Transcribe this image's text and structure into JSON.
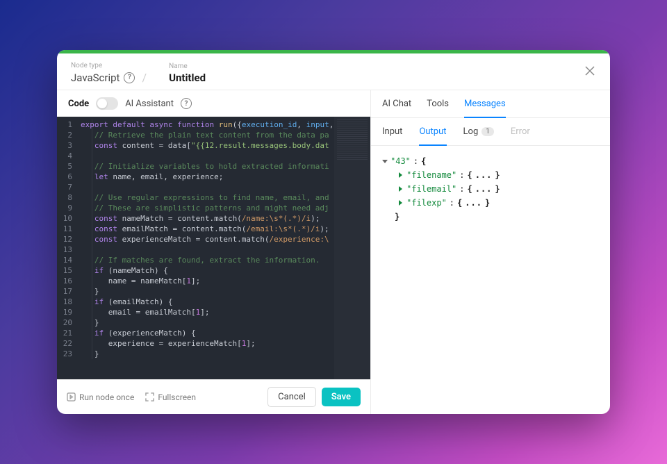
{
  "header": {
    "nodetype_label": "Node type",
    "nodetype_value": "JavaScript",
    "name_label": "Name",
    "name_value": "Untitled"
  },
  "left_tabs": {
    "code": "Code",
    "ai": "AI Assistant"
  },
  "footer": {
    "run_once": "Run node once",
    "fullscreen": "Fullscreen",
    "cancel": "Cancel",
    "save": "Save"
  },
  "right_tabs_1": {
    "ai_chat": "AI Chat",
    "tools": "Tools",
    "messages": "Messages"
  },
  "right_tabs_2": {
    "input": "Input",
    "output": "Output",
    "log": "Log",
    "log_count": "1",
    "error": "Error"
  },
  "code_lines": [
    {
      "n": 1,
      "html": "<span class='kw'>export</span> <span class='kw'>default</span> <span class='kw'>async</span> <span class='kw'>function</span> <span class='fn'>run</span>({<span class='id'>execution_id</span>, <span class='id'>input</span>,"
    },
    {
      "n": 2,
      "html": "   <span class='com'>// Retrieve the plain text content from the data pa</span>"
    },
    {
      "n": 3,
      "html": "   <span class='kw2'>const</span> content = data[<span class='str'>\"{{12.result.messages.body.dat</span>"
    },
    {
      "n": 4,
      "html": ""
    },
    {
      "n": 5,
      "html": "   <span class='com'>// Initialize variables to hold extracted informati</span>"
    },
    {
      "n": 6,
      "html": "   <span class='kw2'>let</span> name, email, experience;"
    },
    {
      "n": 7,
      "html": ""
    },
    {
      "n": 8,
      "html": "   <span class='com'>// Use regular expressions to find name, email, and</span>"
    },
    {
      "n": 9,
      "html": "   <span class='com'>// These are simplistic patterns and might need adj</span>"
    },
    {
      "n": 10,
      "html": "   <span class='kw2'>const</span> nameMatch = content.match(<span class='re'>/name:\\s*(.*)/i</span>);"
    },
    {
      "n": 11,
      "html": "   <span class='kw2'>const</span> emailMatch = content.match(<span class='re'>/email:\\s*(.*)/i</span>);"
    },
    {
      "n": 12,
      "html": "   <span class='kw2'>const</span> experienceMatch = content.match(<span class='re'>/experience:\\</span>"
    },
    {
      "n": 13,
      "html": ""
    },
    {
      "n": 14,
      "html": "   <span class='com'>// If matches are found, extract the information.</span>"
    },
    {
      "n": 15,
      "html": "   <span class='kw'>if</span> (nameMatch) {"
    },
    {
      "n": 16,
      "html": "      name = nameMatch[<span class='num'>1</span>];"
    },
    {
      "n": 17,
      "html": "   }"
    },
    {
      "n": 18,
      "html": "   <span class='kw'>if</span> (emailMatch) {"
    },
    {
      "n": 19,
      "html": "      email = emailMatch[<span class='num'>1</span>];"
    },
    {
      "n": 20,
      "html": "   }"
    },
    {
      "n": 21,
      "html": "   <span class='kw'>if</span> (experienceMatch) {"
    },
    {
      "n": 22,
      "html": "      experience = experienceMatch[<span class='num'>1</span>];"
    },
    {
      "n": 23,
      "html": "   }"
    }
  ],
  "output": {
    "root_key": "\"43\"",
    "children": [
      {
        "key": "\"filename\""
      },
      {
        "key": "\"filemail\""
      },
      {
        "key": "\"filexp\""
      }
    ]
  }
}
